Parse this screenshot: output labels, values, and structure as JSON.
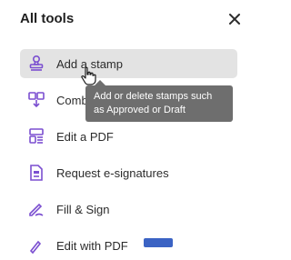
{
  "panel": {
    "title": "All tools",
    "close_icon": "close-icon"
  },
  "tools": [
    {
      "label": "Add a stamp",
      "icon": "stamp-icon"
    },
    {
      "label": "Combine files",
      "icon": "combine-files-icon"
    },
    {
      "label": "Edit a PDF",
      "icon": "edit-pdf-icon"
    },
    {
      "label": "Request e-signatures",
      "icon": "request-signatures-icon"
    },
    {
      "label": "Fill & Sign",
      "icon": "fill-sign-icon"
    },
    {
      "label": "Edit with PDF",
      "icon": "partial-tool-icon"
    }
  ],
  "tooltip": {
    "text": "Add or delete stamps such as Approved or Draft"
  },
  "colors": {
    "accent": "#7b4fd0",
    "hover_bg": "#e3e3e3",
    "tooltip_bg": "#6e6e6e"
  }
}
